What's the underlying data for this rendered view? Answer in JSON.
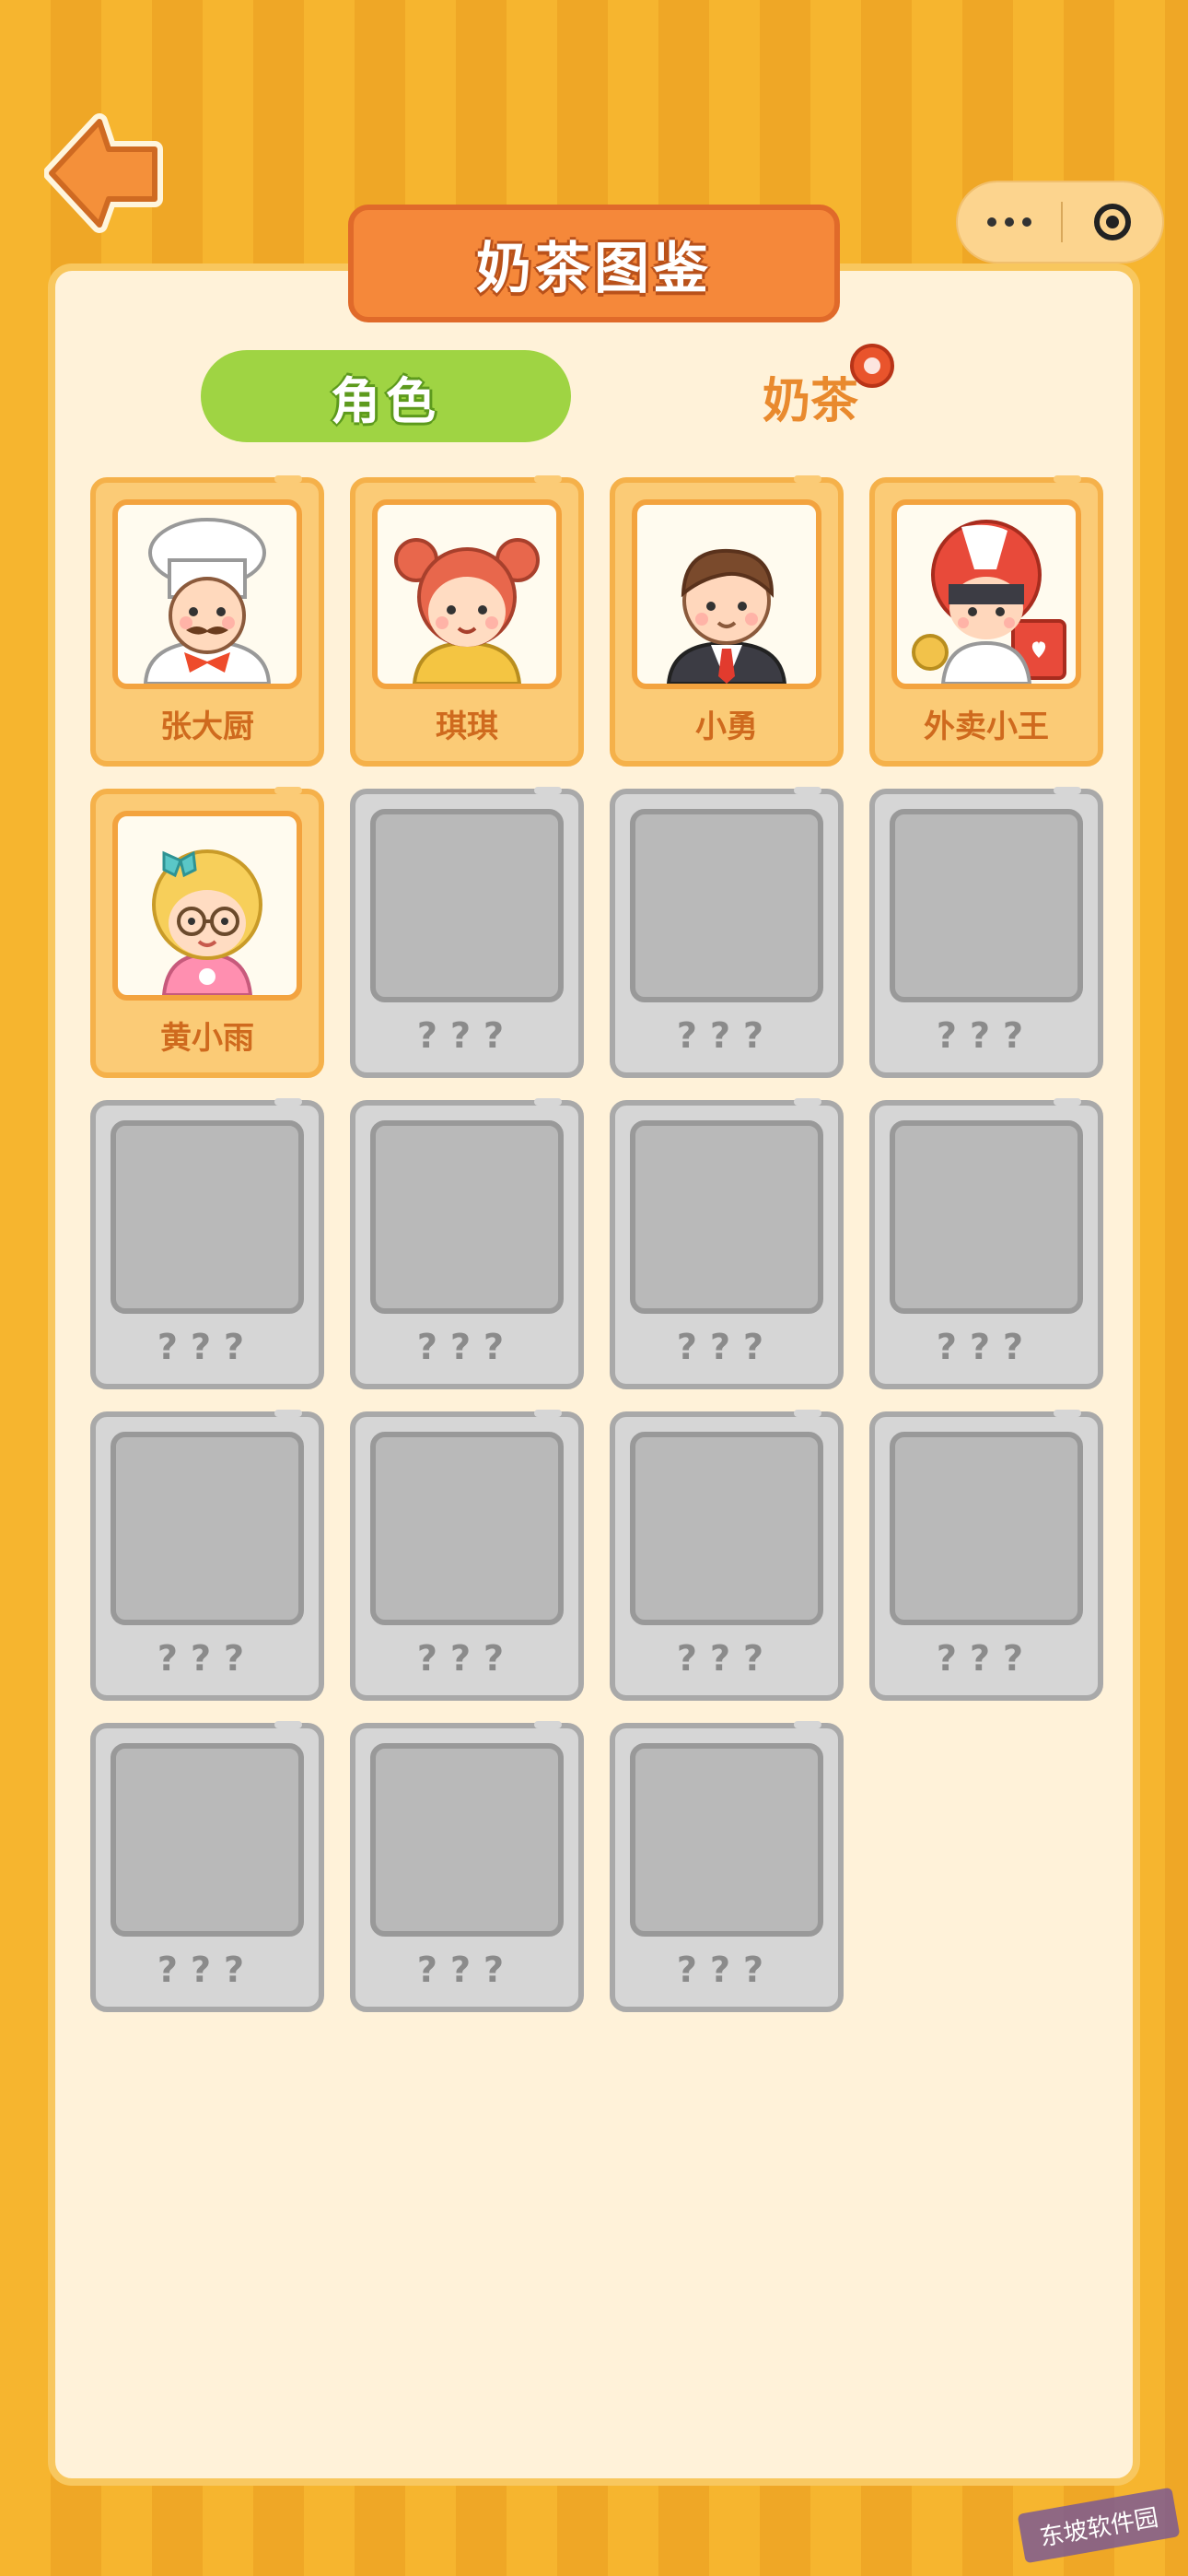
{
  "header": {
    "title": "奶茶图鉴"
  },
  "icons": {
    "back": "back-arrow-icon",
    "more": "more-dots-icon",
    "close": "target-icon",
    "badge": "red-dot-icon"
  },
  "tabs": {
    "roles": "角色",
    "tea": "奶茶"
  },
  "characters": [
    {
      "name": "张大厨",
      "unlocked": true,
      "icon": "chef-icon"
    },
    {
      "name": "琪琪",
      "unlocked": true,
      "icon": "girl-icon"
    },
    {
      "name": "小勇",
      "unlocked": true,
      "icon": "businessman-icon"
    },
    {
      "name": "外卖小王",
      "unlocked": true,
      "icon": "delivery-rider-icon"
    },
    {
      "name": "黄小雨",
      "unlocked": true,
      "icon": "blonde-girl-icon"
    },
    {
      "name": "???",
      "unlocked": false
    },
    {
      "name": "???",
      "unlocked": false
    },
    {
      "name": "???",
      "unlocked": false
    },
    {
      "name": "???",
      "unlocked": false
    },
    {
      "name": "???",
      "unlocked": false
    },
    {
      "name": "???",
      "unlocked": false
    },
    {
      "name": "???",
      "unlocked": false
    },
    {
      "name": "???",
      "unlocked": false
    },
    {
      "name": "???",
      "unlocked": false
    },
    {
      "name": "???",
      "unlocked": false
    },
    {
      "name": "???",
      "unlocked": false
    },
    {
      "name": "???",
      "unlocked": false
    },
    {
      "name": "???",
      "unlocked": false
    },
    {
      "name": "???",
      "unlocked": false
    }
  ],
  "colors": {
    "orange": "#f5883a",
    "green": "#9fd443",
    "panel": "#fff2d9",
    "locked": "#d6d6d6"
  },
  "watermark": "东坡软件园"
}
